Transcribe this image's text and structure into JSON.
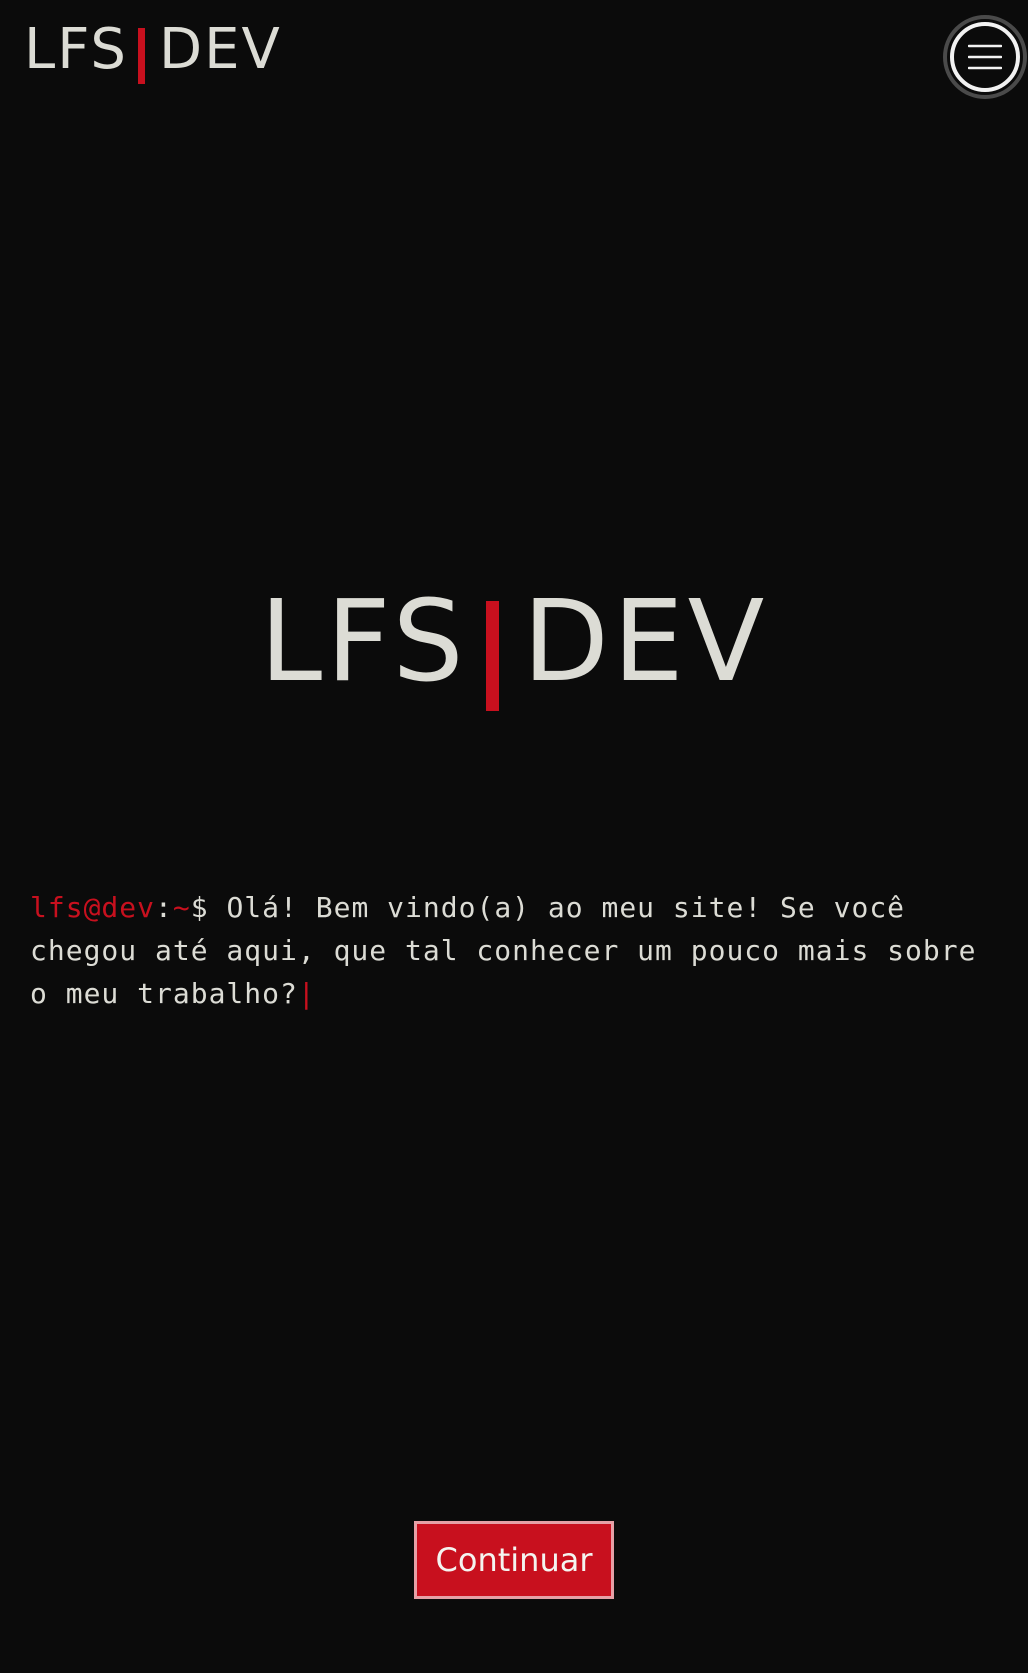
{
  "header": {
    "logo_left": "LFS",
    "logo_right": "DEV",
    "menu_icon": "hamburger-menu-icon"
  },
  "hero": {
    "logo_left": "LFS",
    "logo_right": "DEV"
  },
  "terminal": {
    "user": "lfs@dev",
    "colon": ":",
    "path": "~",
    "dollar": "$",
    "message": " Olá! Bem vindo(a) ao meu site! Se você chegou até aqui, que tal conhecer um pouco mais sobre o meu trabalho?",
    "cursor": "|"
  },
  "actions": {
    "continue_label": "Continuar"
  },
  "colors": {
    "background": "#0b0b0b",
    "accent": "#c8101e",
    "text": "#dcdcd5"
  }
}
